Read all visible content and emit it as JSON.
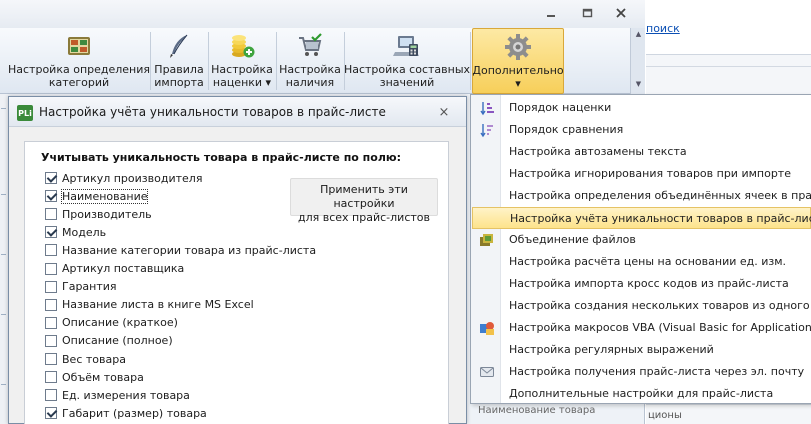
{
  "window": {
    "minimize_icon": "minimize-icon",
    "maximize_icon": "maximize-icon",
    "close_icon": "close-icon"
  },
  "ribbon": {
    "buttons": [
      {
        "label_line1": "Настройка определения",
        "label_line2": "категорий",
        "icon": "category-grid-icon"
      },
      {
        "label_line1": "Правила",
        "label_line2": "импорта",
        "icon": "quill-pen-icon"
      },
      {
        "label_line1": "Настройка",
        "label_line2": "наценки ▾",
        "icon": "coins-add-icon"
      },
      {
        "label_line1": "Настройка",
        "label_line2": "наличия",
        "icon": "cart-check-icon"
      },
      {
        "label_line1": "Настройка составных",
        "label_line2": "значений",
        "icon": "calculator-laptop-icon"
      },
      {
        "label_line1": "Дополнительно",
        "label_line2": "▾",
        "icon": "gear-icon"
      }
    ]
  },
  "right_pane": {
    "search_link": "поиск",
    "bottom_label": "ционы"
  },
  "dialog": {
    "icon_text": "PLi",
    "title": "Настройка учёта уникальности товаров в прайс-листе",
    "close_label": "×",
    "heading": "Учитывать уникальность товара в прайс-листе по полю:",
    "apply_all_line1": "Применить эти настройки",
    "apply_all_line2": "для всех прайс-листов",
    "fields": [
      {
        "label": "Артикул производителя",
        "checked": true
      },
      {
        "label": "Наименование",
        "checked": true
      },
      {
        "label": "Производитель",
        "checked": false
      },
      {
        "label": "Модель",
        "checked": true
      },
      {
        "label": "Название категории товара из прайс-листа",
        "checked": false
      },
      {
        "label": "Артикул поставщика",
        "checked": false
      },
      {
        "label": "Гарантия",
        "checked": false
      },
      {
        "label": "Название листа в книге MS Excel",
        "checked": false
      },
      {
        "label": "Описание (краткое)",
        "checked": false
      },
      {
        "label": "Описание (полное)",
        "checked": false
      },
      {
        "label": "Вес товара",
        "checked": false
      },
      {
        "label": "Объём товара",
        "checked": false
      },
      {
        "label": "Ед. измерения товара",
        "checked": false
      },
      {
        "label": "Габарит (размер) товара",
        "checked": true
      }
    ]
  },
  "menu": {
    "items": [
      {
        "label": "Порядок наценки",
        "icon": "sort-arrows-icon",
        "highlighted": false
      },
      {
        "label": "Порядок сравнения",
        "icon": "sort-compare-icon",
        "highlighted": false
      },
      {
        "label": "Настройка автозамены текста",
        "icon": "",
        "highlighted": false
      },
      {
        "label": "Настройка игнорирования товаров при импорте",
        "icon": "",
        "highlighted": false
      },
      {
        "label": "Настройка определения объединённых ячеек в прайс-л",
        "icon": "",
        "highlighted": false
      },
      {
        "label": "Настройка учёта уникальности товаров в прайс-листе",
        "icon": "",
        "highlighted": true
      },
      {
        "label": "Объединение файлов",
        "icon": "files-merge-icon",
        "highlighted": false
      },
      {
        "label": "Настройка расчёта цены на основании ед. изм.",
        "icon": "",
        "highlighted": false
      },
      {
        "label": "Настройка импорта кросс кодов из прайс-листа",
        "icon": "",
        "highlighted": false
      },
      {
        "label": "Настройка создания нескольких товаров из одного то",
        "icon": "",
        "highlighted": false
      },
      {
        "label": "Настройка макросов VBA (Visual Basic for Applications)",
        "icon": "vba-macro-icon",
        "highlighted": false
      },
      {
        "label": "Настройка регулярных выражений",
        "icon": "",
        "highlighted": false
      },
      {
        "label": "Настройка получения прайс-листа через эл. почту",
        "icon": "mail-icon",
        "highlighted": false
      },
      {
        "label": "Дополнительные настройки для прайс-листа",
        "icon": "",
        "highlighted": false
      }
    ]
  },
  "below_menu_text": "Наименование товара",
  "colors": {
    "highlight_top": "#fff3c8",
    "highlight_bottom": "#fde38b",
    "pressed_button": "#f7cf5a",
    "link": "#0b4fb4"
  }
}
